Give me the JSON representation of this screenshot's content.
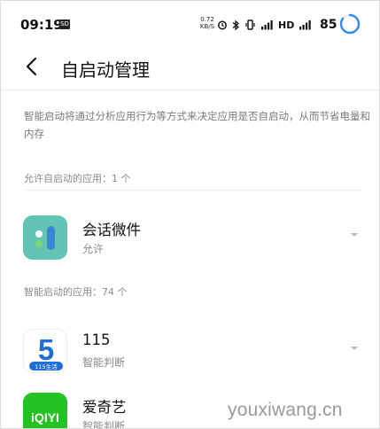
{
  "status_bar": {
    "time": "09:19",
    "sd_badge": "SD",
    "net_speed_value": "0.72",
    "net_speed_unit": "KB/S",
    "hd_label": "HD",
    "battery_level": "85",
    "battery_percent": 85,
    "accent_color": "#2f8af5"
  },
  "header": {
    "title": "自启动管理"
  },
  "description": "智能启动将通过分析应用行为等方式来决定应用是否自启动，从而节省电量和内存",
  "sections": {
    "allowed": {
      "label": "允许自启动的应用：1 个",
      "apps": [
        {
          "name": "会话微件",
          "status": "允许",
          "icon": "chat-widget-icon"
        }
      ]
    },
    "smart": {
      "label": "智能启动的应用：74 个",
      "apps": [
        {
          "name": "115",
          "status": "智能判断",
          "icon": "115-app-icon",
          "icon_text": "5",
          "icon_badge": "115生活"
        },
        {
          "name": "爱奇艺",
          "status": "智能判断",
          "icon": "iqiyi-app-icon",
          "icon_text": "iQIYI"
        }
      ]
    }
  },
  "watermark": "youxiwang.cn"
}
